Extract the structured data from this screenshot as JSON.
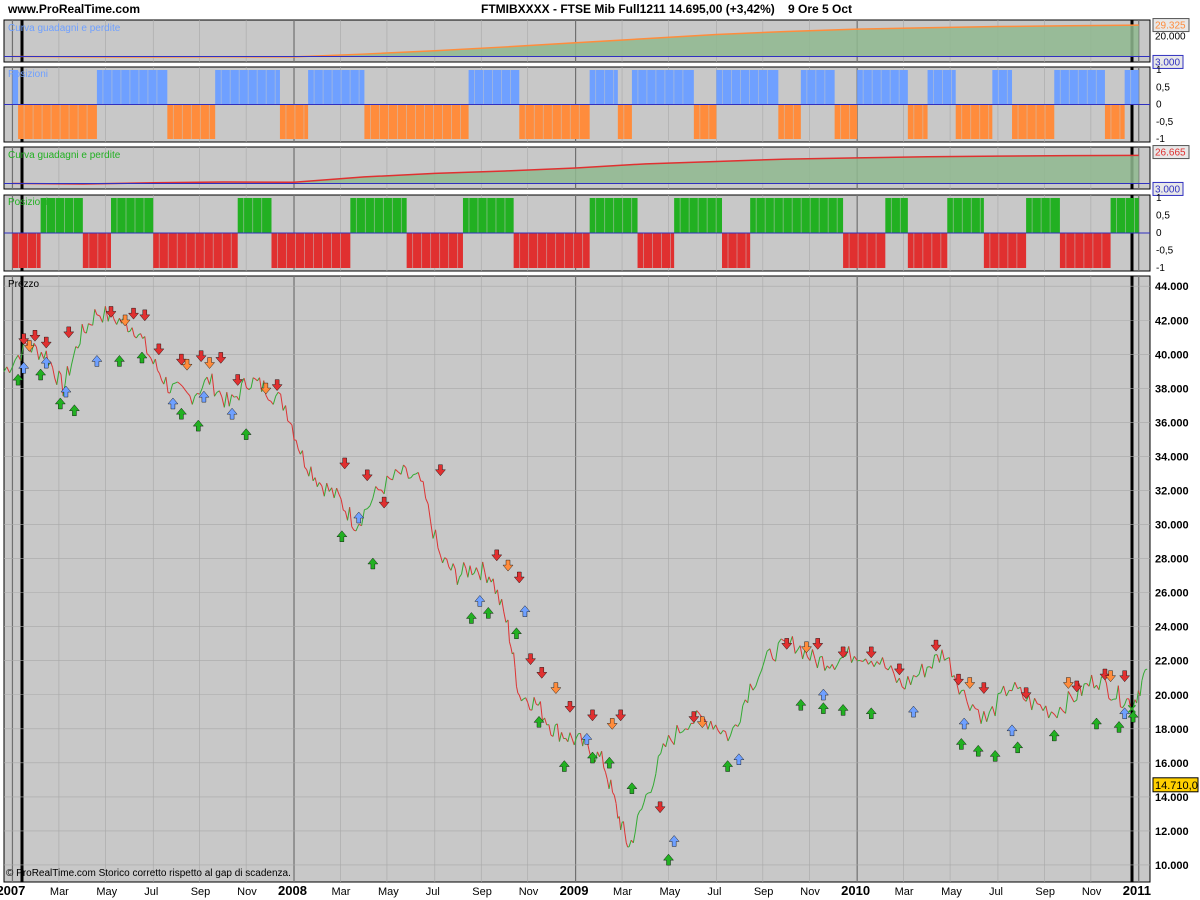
{
  "header": {
    "site": "www.ProRealTime.com",
    "instrument": "FTMIBXXXX - FTSE Mib Full1211",
    "quote": "14.695,00 (+3,42%)",
    "session": "9 Ore  5 Oct"
  },
  "footer": {
    "note": "© ProRealTime.com  Storico corretto rispetto al gap di scadenza."
  },
  "colors": {
    "panel_bg": "#c8c8c8",
    "grid": "#a8a8a8",
    "blue": "#6fa0ff",
    "orange": "#ff8c3c",
    "green": "#22b022",
    "red": "#e03030",
    "equity_fill": "#8fb88f",
    "price_box": "#ffd000"
  },
  "chart_data": [
    {
      "type": "area",
      "panel": "equity-1",
      "title": "Curva guadagni e perdite",
      "last_value_label": "29.325",
      "baseline_label": "3.000",
      "y_ticks": [
        "20.000"
      ],
      "x": [
        "2007-01",
        "2007-04",
        "2007-07",
        "2007-10",
        "2008-01",
        "2008-04",
        "2008-07",
        "2008-10",
        "2009-01",
        "2009-04",
        "2009-07",
        "2009-10",
        "2010-01",
        "2010-04",
        "2010-07",
        "2010-10",
        "2011-01"
      ],
      "series": [
        {
          "values": [
            3000,
            2600,
            2500,
            2700,
            2600,
            5000,
            7800,
            11000,
            14500,
            18000,
            21500,
            24000,
            26000,
            27200,
            28200,
            28800,
            29325
          ]
        }
      ]
    },
    {
      "type": "bar",
      "panel": "positions-1",
      "title": "Posizioni",
      "y_ticks": [
        "1",
        "0,5",
        "0",
        "-0,5",
        "-1"
      ],
      "segments": [
        [
          2007.0,
          2007.02,
          1
        ],
        [
          2007.02,
          2007.3,
          -1
        ],
        [
          2007.3,
          2007.55,
          1
        ],
        [
          2007.55,
          2007.72,
          -1
        ],
        [
          2007.72,
          2007.95,
          1
        ],
        [
          2007.95,
          2008.05,
          -1
        ],
        [
          2008.05,
          2008.25,
          1
        ],
        [
          2008.25,
          2008.62,
          -1
        ],
        [
          2008.62,
          2008.8,
          1
        ],
        [
          2008.8,
          2009.05,
          -1
        ],
        [
          2009.05,
          2009.15,
          1
        ],
        [
          2009.15,
          2009.2,
          -1
        ],
        [
          2009.2,
          2009.42,
          1
        ],
        [
          2009.42,
          2009.5,
          -1
        ],
        [
          2009.5,
          2009.72,
          1
        ],
        [
          2009.72,
          2009.8,
          -1
        ],
        [
          2009.8,
          2009.92,
          1
        ],
        [
          2009.92,
          2010.0,
          -1
        ],
        [
          2010.0,
          2010.18,
          1
        ],
        [
          2010.18,
          2010.25,
          -1
        ],
        [
          2010.25,
          2010.35,
          1
        ],
        [
          2010.35,
          2010.48,
          -1
        ],
        [
          2010.48,
          2010.55,
          1
        ],
        [
          2010.55,
          2010.7,
          -1
        ],
        [
          2010.7,
          2010.88,
          1
        ],
        [
          2010.88,
          2010.95,
          -1
        ],
        [
          2010.95,
          2011.0,
          1
        ]
      ]
    },
    {
      "type": "area",
      "panel": "equity-2",
      "title": "Curva guadagni e perdite",
      "last_value_label": "26.665",
      "baseline_label": "3.000",
      "x": [
        "2007-01",
        "2007-04",
        "2007-07",
        "2007-10",
        "2008-01",
        "2008-04",
        "2008-07",
        "2008-10",
        "2009-01",
        "2009-04",
        "2009-07",
        "2009-10",
        "2010-01",
        "2010-04",
        "2010-07",
        "2010-10",
        "2011-01"
      ],
      "series": [
        {
          "values": [
            3000,
            2500,
            3600,
            4200,
            4000,
            8500,
            11500,
            13500,
            16000,
            19500,
            21500,
            23500,
            24500,
            25500,
            26000,
            26400,
            26665
          ]
        }
      ]
    },
    {
      "type": "bar",
      "panel": "positions-2",
      "title": "Posizioni",
      "y_ticks": [
        "1",
        "0,5",
        "0",
        "-0,5",
        "-1"
      ],
      "segments": [
        [
          2007.0,
          2007.1,
          -1
        ],
        [
          2007.1,
          2007.25,
          1
        ],
        [
          2007.25,
          2007.35,
          -1
        ],
        [
          2007.35,
          2007.5,
          1
        ],
        [
          2007.5,
          2007.8,
          -1
        ],
        [
          2007.8,
          2007.92,
          1
        ],
        [
          2007.92,
          2008.2,
          -1
        ],
        [
          2008.2,
          2008.4,
          1
        ],
        [
          2008.4,
          2008.6,
          -1
        ],
        [
          2008.6,
          2008.78,
          1
        ],
        [
          2008.78,
          2009.05,
          -1
        ],
        [
          2009.05,
          2009.22,
          1
        ],
        [
          2009.22,
          2009.35,
          -1
        ],
        [
          2009.35,
          2009.52,
          1
        ],
        [
          2009.52,
          2009.62,
          -1
        ],
        [
          2009.62,
          2009.95,
          1
        ],
        [
          2009.95,
          2010.1,
          -1
        ],
        [
          2010.1,
          2010.18,
          1
        ],
        [
          2010.18,
          2010.32,
          -1
        ],
        [
          2010.32,
          2010.45,
          1
        ],
        [
          2010.45,
          2010.6,
          -1
        ],
        [
          2010.6,
          2010.72,
          1
        ],
        [
          2010.72,
          2010.9,
          -1
        ],
        [
          2010.9,
          2011.0,
          1
        ]
      ]
    },
    {
      "type": "line",
      "panel": "price",
      "title": "Prezzo",
      "y_ticks": [
        "44.000",
        "42.000",
        "40.000",
        "38.000",
        "36.000",
        "34.000",
        "32.000",
        "30.000",
        "28.000",
        "26.000",
        "24.000",
        "22.000",
        "20.000",
        "18.000",
        "16.000",
        "14.000",
        "12.000",
        "10.000"
      ],
      "ylim": [
        9000,
        44000
      ],
      "last_price_label": "14.710,0",
      "x_ticks": [
        "2007",
        "Mar",
        "May",
        "Jul",
        "Sep",
        "Nov",
        "2008",
        "Mar",
        "May",
        "Jul",
        "Sep",
        "Nov",
        "2009",
        "Mar",
        "May",
        "Jul",
        "Sep",
        "Nov",
        "2010",
        "Mar",
        "May",
        "Jul",
        "Sep",
        "Nov",
        "2011"
      ],
      "x_tick_dates": [
        2007.0,
        2007.165,
        2007.33,
        2007.5,
        2007.665,
        2007.83,
        2008.0,
        2008.165,
        2008.33,
        2008.5,
        2008.665,
        2008.83,
        2009.0,
        2009.165,
        2009.33,
        2009.5,
        2009.665,
        2009.83,
        2010.0,
        2010.165,
        2010.33,
        2010.5,
        2010.665,
        2010.83,
        2011.0
      ],
      "x": [
        2006.97,
        2007.05,
        2007.12,
        2007.18,
        2007.24,
        2007.3,
        2007.38,
        2007.44,
        2007.5,
        2007.56,
        2007.63,
        2007.7,
        2007.77,
        2007.84,
        2007.9,
        2007.97,
        2008.03,
        2008.09,
        2008.16,
        2008.22,
        2008.3,
        2008.38,
        2008.45,
        2008.52,
        2008.58,
        2008.64,
        2008.7,
        2008.76,
        2008.8,
        2008.86,
        2008.92,
        2008.98,
        2009.04,
        2009.1,
        2009.15,
        2009.19,
        2009.25,
        2009.32,
        2009.4,
        2009.48,
        2009.55,
        2009.62,
        2009.7,
        2009.78,
        2009.85,
        2009.92,
        2010.0,
        2010.08,
        2010.16,
        2010.24,
        2010.31,
        2010.38,
        2010.46,
        2010.54,
        2010.62,
        2010.7,
        2010.78,
        2010.85,
        2010.92,
        2010.98,
        2011.03
      ],
      "values": [
        39000,
        40500,
        40000,
        38000,
        41000,
        42500,
        42000,
        41500,
        39500,
        38000,
        37500,
        38500,
        37000,
        38500,
        38000,
        37000,
        34000,
        32500,
        31500,
        30000,
        32000,
        33000,
        32500,
        28000,
        27000,
        27500,
        27000,
        24000,
        20000,
        19500,
        18000,
        17500,
        17000,
        16000,
        13000,
        11000,
        14000,
        17000,
        18500,
        18500,
        17500,
        20500,
        22500,
        23000,
        22000,
        22000,
        22500,
        22000,
        20500,
        21500,
        22500,
        20000,
        18500,
        20500,
        19500,
        19000,
        20000,
        21000,
        20000,
        19500,
        21500
      ],
      "signals": [
        [
          2007.04,
          40800,
          "sell"
        ],
        [
          2007.08,
          41000,
          "sell"
        ],
        [
          2007.12,
          40600,
          "sell"
        ],
        [
          2007.2,
          41200,
          "sell"
        ],
        [
          2007.35,
          42400,
          "sell"
        ],
        [
          2007.43,
          42300,
          "sell"
        ],
        [
          2007.47,
          42200,
          "sell"
        ],
        [
          2007.52,
          40200,
          "sell"
        ],
        [
          2007.6,
          39600,
          "sell"
        ],
        [
          2007.67,
          39800,
          "sell"
        ],
        [
          2007.74,
          39700,
          "sell"
        ],
        [
          2007.8,
          38400,
          "sell"
        ],
        [
          2007.94,
          38100,
          "sell"
        ],
        [
          2008.18,
          33500,
          "sell"
        ],
        [
          2008.26,
          32800,
          "sell"
        ],
        [
          2008.32,
          31200,
          "sell"
        ],
        [
          2008.52,
          33100,
          "sell"
        ],
        [
          2008.72,
          28100,
          "sell"
        ],
        [
          2008.8,
          26800,
          "sell"
        ],
        [
          2008.84,
          22000,
          "sell"
        ],
        [
          2008.88,
          21200,
          "sell"
        ],
        [
          2008.98,
          19200,
          "sell"
        ],
        [
          2009.06,
          18700,
          "sell"
        ],
        [
          2009.16,
          18700,
          "sell"
        ],
        [
          2009.3,
          13300,
          "sell"
        ],
        [
          2009.42,
          18600,
          "sell"
        ],
        [
          2009.75,
          22900,
          "sell"
        ],
        [
          2009.86,
          22900,
          "sell"
        ],
        [
          2009.95,
          22400,
          "sell"
        ],
        [
          2010.05,
          22400,
          "sell"
        ],
        [
          2010.15,
          21400,
          "sell"
        ],
        [
          2010.28,
          22800,
          "sell"
        ],
        [
          2010.36,
          20800,
          "sell"
        ],
        [
          2010.45,
          20300,
          "sell"
        ],
        [
          2010.6,
          20000,
          "sell"
        ],
        [
          2010.78,
          20400,
          "sell"
        ],
        [
          2010.88,
          21100,
          "sell"
        ],
        [
          2010.95,
          21000,
          "sell"
        ],
        [
          2007.06,
          40400,
          "sell2"
        ],
        [
          2007.4,
          41900,
          "sell2"
        ],
        [
          2007.62,
          39300,
          "sell2"
        ],
        [
          2007.7,
          39400,
          "sell2"
        ],
        [
          2007.9,
          37900,
          "sell2"
        ],
        [
          2008.76,
          27500,
          "sell2"
        ],
        [
          2008.93,
          20300,
          "sell2"
        ],
        [
          2009.13,
          18200,
          "sell2"
        ],
        [
          2009.45,
          18300,
          "sell2"
        ],
        [
          2009.82,
          22700,
          "sell2"
        ],
        [
          2010.4,
          20600,
          "sell2"
        ],
        [
          2010.75,
          20600,
          "sell2"
        ],
        [
          2010.9,
          21000,
          "sell2"
        ],
        [
          2007.02,
          38600,
          "buy"
        ],
        [
          2007.1,
          38900,
          "buy"
        ],
        [
          2007.17,
          37200,
          "buy"
        ],
        [
          2007.22,
          36800,
          "buy"
        ],
        [
          2007.38,
          39700,
          "buy"
        ],
        [
          2007.46,
          39900,
          "buy"
        ],
        [
          2007.6,
          36600,
          "buy"
        ],
        [
          2007.66,
          35900,
          "buy"
        ],
        [
          2007.83,
          35400,
          "buy"
        ],
        [
          2008.17,
          29400,
          "buy"
        ],
        [
          2008.28,
          27800,
          "buy"
        ],
        [
          2008.63,
          24600,
          "buy"
        ],
        [
          2008.69,
          24900,
          "buy"
        ],
        [
          2008.79,
          23700,
          "buy"
        ],
        [
          2008.87,
          18500,
          "buy"
        ],
        [
          2008.96,
          15900,
          "buy"
        ],
        [
          2009.06,
          16400,
          "buy"
        ],
        [
          2009.12,
          16100,
          "buy"
        ],
        [
          2009.2,
          14600,
          "buy"
        ],
        [
          2009.33,
          10400,
          "buy"
        ],
        [
          2009.54,
          15900,
          "buy"
        ],
        [
          2009.8,
          19500,
          "buy"
        ],
        [
          2009.88,
          19300,
          "buy"
        ],
        [
          2009.95,
          19200,
          "buy"
        ],
        [
          2010.05,
          19000,
          "buy"
        ],
        [
          2010.37,
          17200,
          "buy"
        ],
        [
          2010.43,
          16800,
          "buy"
        ],
        [
          2010.49,
          16500,
          "buy"
        ],
        [
          2010.57,
          17000,
          "buy"
        ],
        [
          2010.7,
          17700,
          "buy"
        ],
        [
          2010.85,
          18400,
          "buy"
        ],
        [
          2010.93,
          18200,
          "buy"
        ],
        [
          2010.98,
          18800,
          "buy"
        ],
        [
          2007.04,
          39300,
          "buy2"
        ],
        [
          2007.12,
          39600,
          "buy2"
        ],
        [
          2007.19,
          37900,
          "buy2"
        ],
        [
          2007.3,
          39700,
          "buy2"
        ],
        [
          2007.57,
          37200,
          "buy2"
        ],
        [
          2007.68,
          37600,
          "buy2"
        ],
        [
          2007.78,
          36600,
          "buy2"
        ],
        [
          2008.23,
          30500,
          "buy2"
        ],
        [
          2008.66,
          25600,
          "buy2"
        ],
        [
          2008.82,
          25000,
          "buy2"
        ],
        [
          2009.04,
          17500,
          "buy2"
        ],
        [
          2009.35,
          11500,
          "buy2"
        ],
        [
          2009.58,
          16300,
          "buy2"
        ],
        [
          2009.88,
          20100,
          "buy2"
        ],
        [
          2010.2,
          19100,
          "buy2"
        ],
        [
          2010.38,
          18400,
          "buy2"
        ],
        [
          2010.55,
          18000,
          "buy2"
        ],
        [
          2010.95,
          19000,
          "buy2"
        ]
      ]
    }
  ]
}
